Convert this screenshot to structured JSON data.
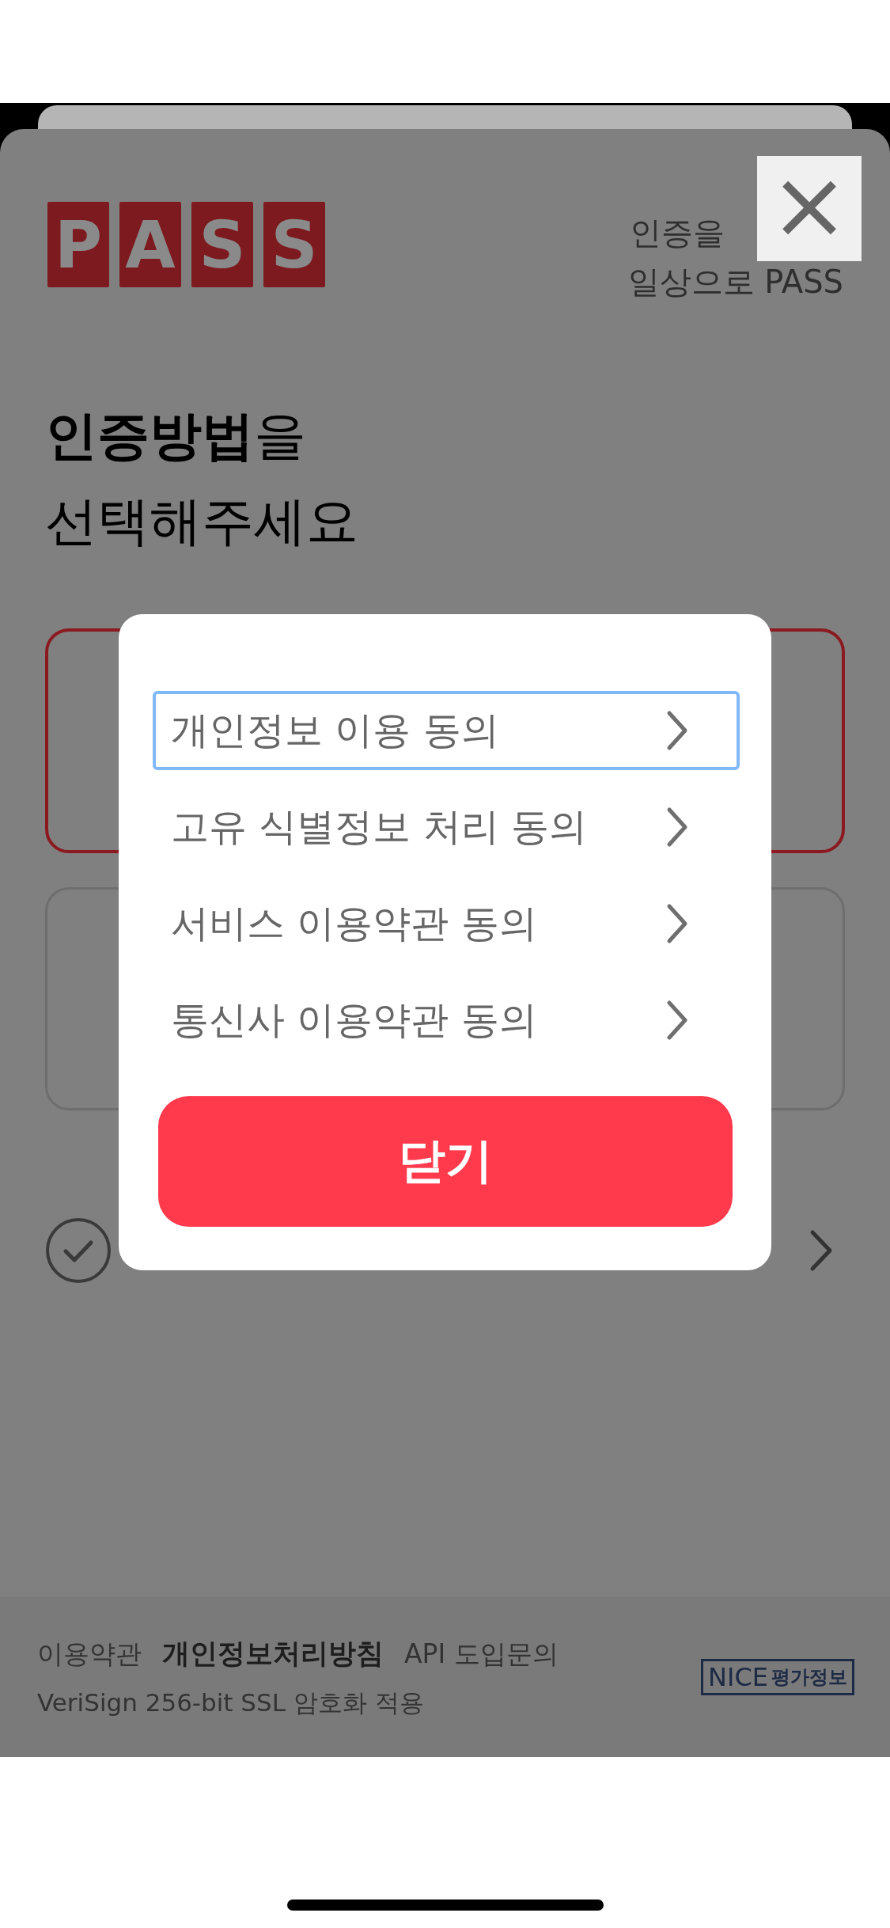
{
  "header": {
    "logo_letters": [
      "P",
      "A",
      "S",
      "S"
    ],
    "tagline": [
      "인증을",
      "일상으로 PASS"
    ],
    "close_button": {
      "label": "×"
    }
  },
  "title": {
    "lines": [
      "**인증방법**을",
      "선택해주세요"
    ]
  },
  "method_cards": [
    {
      "selected": true
    },
    {
      "selected": false
    }
  ],
  "agree_all": {
    "checked": false
  },
  "footer": {
    "links": [
      {
        "label": "이용약관",
        "emphasized": false
      },
      {
        "label": "개인정보처리방침",
        "emphasized": true
      },
      {
        "label": "API 도입문의",
        "emphasized": false
      }
    ],
    "security_note": "VeriSign 256-bit SSL 암호화 적용",
    "partner_logo": {
      "name": "NICE",
      "suffix": "평가정보"
    }
  },
  "dialog": {
    "items": [
      {
        "label": "개인정보 이용 동의",
        "focused": true
      },
      {
        "label": "고유 식별정보 처리 동의",
        "focused": false
      },
      {
        "label": "서비스 이용약관 동의",
        "focused": false
      },
      {
        "label": "통신사 이용약관 동의",
        "focused": false
      }
    ],
    "close_button": "닫기"
  }
}
